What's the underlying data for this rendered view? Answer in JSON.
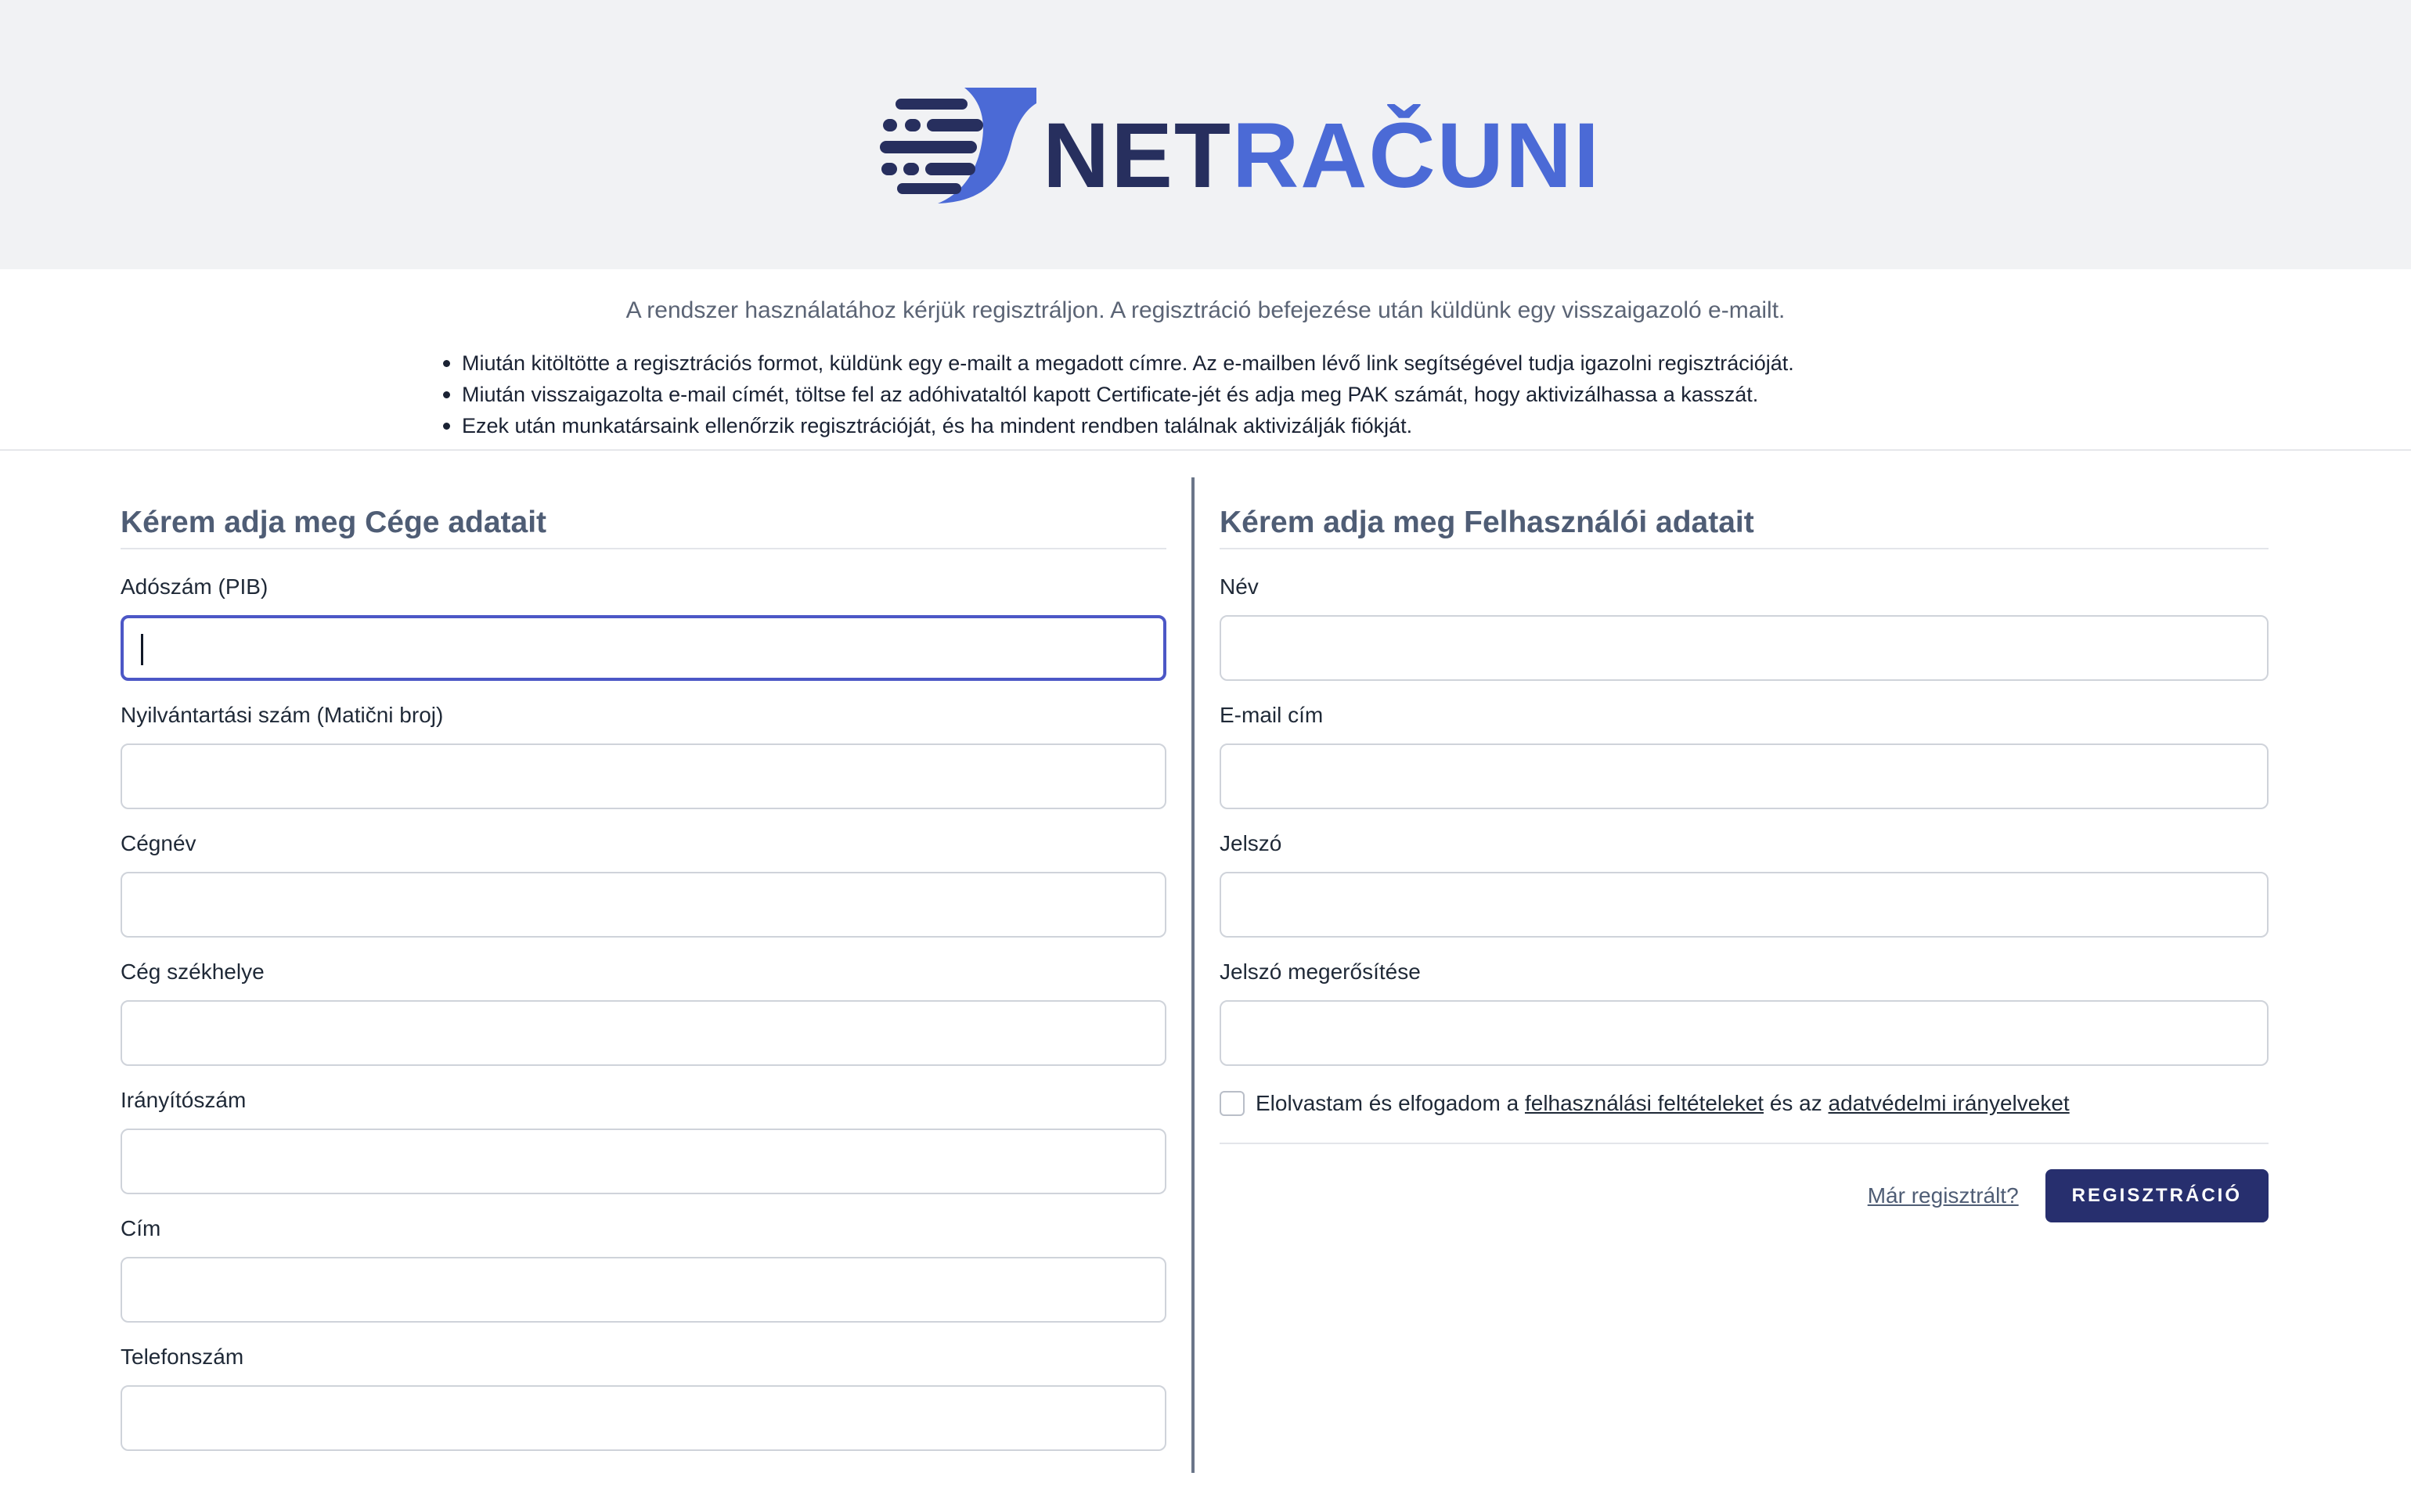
{
  "header": {
    "logo_part1": "NET",
    "logo_part2": "RAČUNI",
    "colors": {
      "brand_dark": "#272f5e",
      "brand_blue": "#4b6ad6",
      "button": "#272f6e",
      "focus": "#4c57c6"
    }
  },
  "intro": {
    "line": "A rendszer használatához kérjük regisztráljon. A regisztráció befejezése után küldünk egy visszaigazoló e-mailt.",
    "bullets": [
      "Miután kitöltötte a regisztrációs formot, küldünk egy e-mailt a megadott címre. Az e-mailben lévő link segítségével tudja igazolni regisztrációját.",
      "Miután visszaigazolta e-mail címét, töltse fel az adóhivataltól kapott Certificate-jét és adja meg PAK számát, hogy aktivizálhassa a kasszát.",
      "Ezek után munkatársaink ellenőrzik regisztrációját, és ha mindent rendben találnak aktivizálják fiókját."
    ]
  },
  "company": {
    "title": "Kérem adja meg Cége adatait",
    "fields": [
      {
        "label": "Adószám (PIB)",
        "value": ""
      },
      {
        "label": "Nyilvántartási szám (Matični broj)",
        "value": ""
      },
      {
        "label": "Cégnév",
        "value": ""
      },
      {
        "label": "Cég székhelye",
        "value": ""
      },
      {
        "label": "Irányítószám",
        "value": ""
      },
      {
        "label": "Cím",
        "value": ""
      },
      {
        "label": "Telefonszám",
        "value": ""
      }
    ]
  },
  "user": {
    "title": "Kérem adja meg Felhasználói adatait",
    "fields": [
      {
        "label": "Név",
        "value": ""
      },
      {
        "label": "E-mail cím",
        "value": ""
      },
      {
        "label": "Jelszó",
        "value": ""
      },
      {
        "label": "Jelszó megerősítése",
        "value": ""
      }
    ],
    "terms": {
      "prefix": "Elolvastam és elfogadom a ",
      "terms_link": "felhasználási feltételeket",
      "middle": " és az ",
      "privacy_link": "adatvédelmi irányelveket",
      "checked": false
    },
    "login_link": "Már regisztrált?",
    "register_button": "REGISZTRÁCIÓ"
  }
}
